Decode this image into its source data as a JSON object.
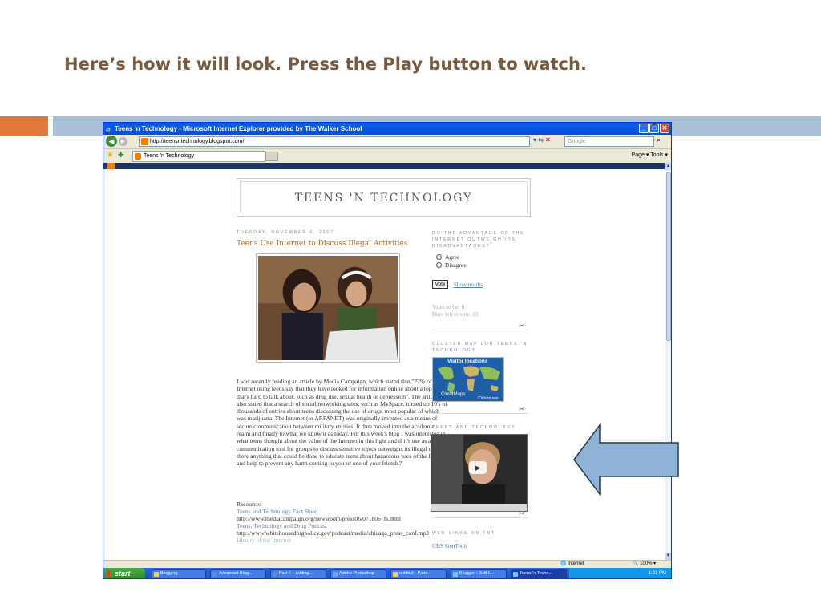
{
  "slide": {
    "title": "Here’s how it will look.  Press the Play button to watch."
  },
  "colors": {
    "slide_title": "#7a5a3f",
    "accent_orange": "#e07a3a",
    "accent_blue": "#a9c0d9",
    "arrow_fill": "#8eb3d6",
    "post_title": "#cc6600",
    "link": "#5a7fa8"
  },
  "browser": {
    "title": "Teens 'n Technology - Microsoft Internet Explorer provided by The Walker School",
    "url": "http://teensntechnology.blogspot.com/",
    "search_placeholder": "Google",
    "tab_label": "Teens 'n Technology",
    "tools_text": "Page ▾  Tools ▾",
    "status_zone": "Internet",
    "zoom": "100%"
  },
  "blog": {
    "header": "TEENS 'N TECHNOLOGY",
    "post_date": "TUESDAY, NOVEMBER 6, 2007",
    "post_title": "Teens Use Internet to Discuss Illegal Activities",
    "post_body": "I was recently reading an article by Media Campaign, which stated that \"22% of Internet using teens say that they have looked for information online about a topic that's hard to talk about, such as drug use, sexual health or depression\". The article also stated that a search of social networking sites, such as MySpace, turned up 10's of thousands of entries about teens discussing the use of drugs, most popular of which was marijuana. The Internet (or ARPANET) was originally invented as a means of secure communication between military entities. It then moved into the academic realm and finally to what we know it as today. For this week's blog I was interested in what teens thought about the value of the Internet in this light and if it's use as a communication tool for groups to discuss sensitive topics outweighs its illegal uses? Is there anything that could be done to educate teens about hazardous uses of the Internet and help to prevent any harm coming to you or one of your friends?",
    "resources_label": "Resources",
    "resource_1_title": "Teens and Technology Fact Sheet",
    "resource_1_url": "http://www.mediacampaign.org/newsroom/press06/071806_fs.html",
    "resource_2_title": "Teens, Technology and Drug Podcast",
    "resource_2_url": "http://www.whitehousedrugpolicy.gov/podcast/media/chicago_press_conf.mp3",
    "resource_3_title": "History of the Internet"
  },
  "sidebar": {
    "poll_heading": "DO THE ADVANTAGE OF THE INTERNET OUTWEIGH ITS DISADVANTAGES?",
    "poll_option_1": "Agree",
    "poll_option_2": "Disagree",
    "vote_label": "Vote",
    "show_results": "Show results",
    "votes_so_far": "Votes so far: 0",
    "days_left": "Days left to vote: 13",
    "cluster_heading": "CLUSTER MAP FOR TEENS 'N TECHNOLOGY",
    "map_label": "Visitor locations",
    "map_brand": "ClustrMaps",
    "map_click": "Click to see",
    "video_heading": "TEENS AND TECHNOLOGY",
    "weblinks_heading": "WEB LINKS ON TNT",
    "weblink_1": "CBS GenTech"
  },
  "taskbar": {
    "start": "start",
    "tasks": [
      "Blogging",
      "Advanced Blog...",
      "Part II – Adding...",
      "Adobe Photoshop",
      "untitled - Paint",
      "Blogger :: Edit L...",
      "Teens 'n Techn..."
    ],
    "clock": "1:31 PM"
  }
}
